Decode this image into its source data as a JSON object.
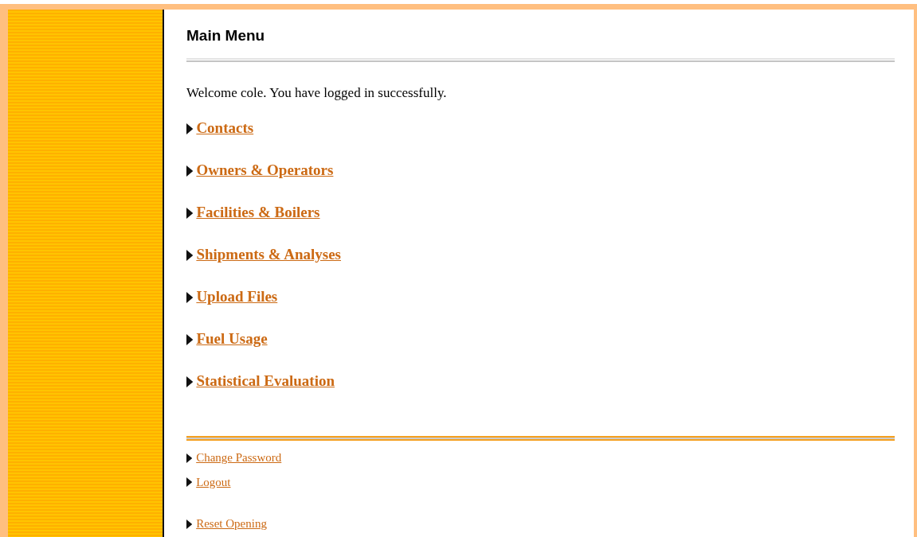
{
  "title": "Main Menu",
  "welcome": "Welcome cole. You have logged in successfully.",
  "main_links": [
    "Contacts",
    "Owners & Operators",
    "Facilities & Boilers",
    "Shipments & Analyses",
    "Upload Files",
    "Fuel Usage",
    "Statistical Evaluation"
  ],
  "account_links": [
    [
      "Change Password",
      "Logout"
    ],
    [
      "Reset Opening"
    ]
  ]
}
